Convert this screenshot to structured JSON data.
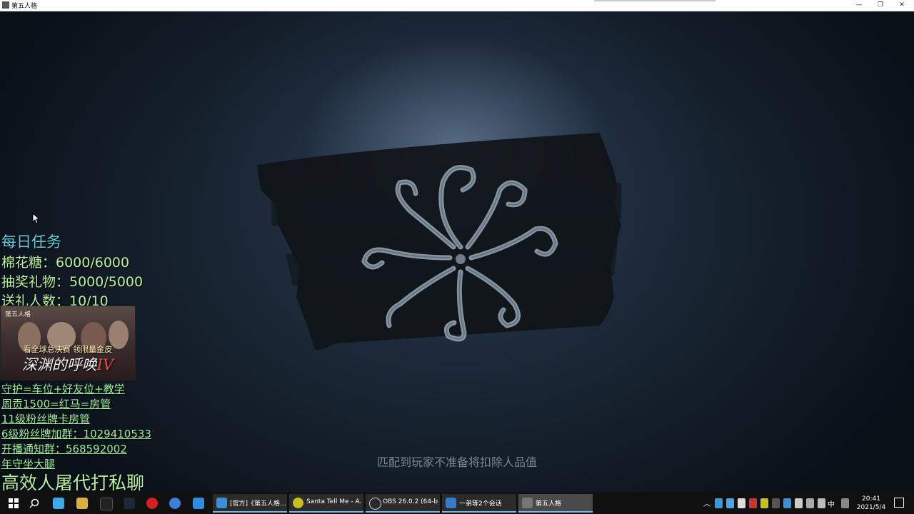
{
  "window": {
    "title": "第五人格",
    "minimize_glyph": "—",
    "restore_glyph": "❐",
    "close_glyph": "✕"
  },
  "overlay": {
    "task_title": "每日任务",
    "lines": [
      "棉花糖：6000/6000",
      "抽奖礼物：5000/5000",
      "送礼人数：10/10"
    ],
    "banner": {
      "logo": "第五人格",
      "subtitle": "看全球总决赛 领限量金皮",
      "main": "深渊的呼唤",
      "main_roman": "IV"
    },
    "links": [
      "守护=车位+好友位+教学",
      "周贡1500=红马=房管",
      "11级粉丝牌卡房管",
      "6级粉丝牌加群：1029410533",
      "开播通知群：568592002",
      "年守坐大腿"
    ],
    "big_line": "高效人屠代打私聊"
  },
  "game": {
    "hint": "匹配到玩家不准备将扣除人品值"
  },
  "taskbar": {
    "tasks": [
      {
        "label": "[官方]《第五人格...",
        "icon_color": "#3a8fd8"
      },
      {
        "label": "Santa Tell Me - A...",
        "icon_color": "#c8c020"
      },
      {
        "label": "OBS 26.0.2 (64-bi...",
        "icon_color": "#2a2a2a"
      },
      {
        "label": "一弟等2个会话",
        "icon_color": "#3a78c8"
      },
      {
        "label": "第五人格",
        "icon_color": "#777777"
      }
    ],
    "time": "20:41",
    "date": "2021/5/4",
    "lang": "中"
  }
}
